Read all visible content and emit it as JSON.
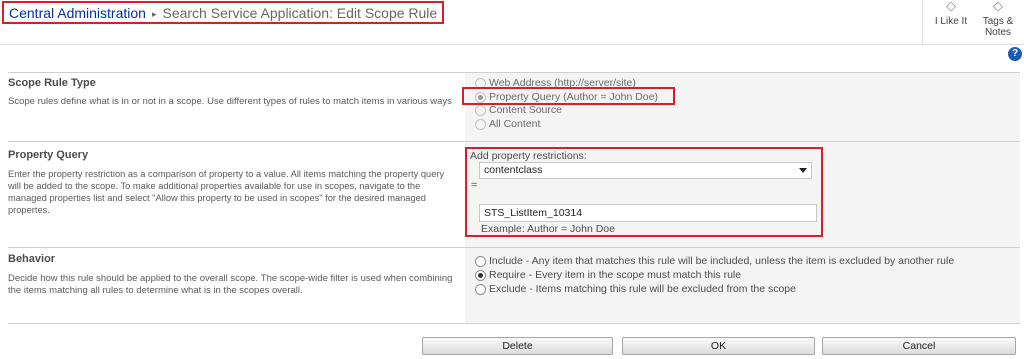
{
  "breadcrumb": {
    "root": "Central Administration",
    "separator": "▸",
    "page": "Search Service Application: Edit Scope Rule"
  },
  "ribbon": {
    "like_label": "I Like It",
    "tags_label_1": "Tags &",
    "tags_label_2": "Notes"
  },
  "help_glyph": "?",
  "scope_rule_type": {
    "title": "Scope Rule Type",
    "description": "Scope rules define what is in or not in a scope. Use different types of rules to match items in various ways",
    "options": [
      {
        "label": "Web Address (http://server/site)",
        "checked": false
      },
      {
        "label": "Property Query (Author = John Doe)",
        "checked": true
      },
      {
        "label": "Content Source",
        "checked": false
      },
      {
        "label": "All Content",
        "checked": false
      }
    ]
  },
  "property_query": {
    "title": "Property Query",
    "description": "Enter the property restriction as a comparison of property to a value. All items matching the property query will be added to the scope. To make additional properties available for use in scopes, navigate to the managed properties list and select \"Allow this property to be used in scopes\" for the desired managed propertes.",
    "add_label": "Add property restrictions:",
    "property_selected": "contentclass",
    "operator": "=",
    "value": "STS_ListItem_10314",
    "example": "Example: Author = John Doe"
  },
  "behavior": {
    "title": "Behavior",
    "description": "Decide how this rule should be applied to the overall scope. The scope-wide filter is used when combining the items matching all rules to determine what is in the scopes overall.",
    "options": [
      {
        "label": "Include - Any item that matches this rule will be included, unless the item is excluded by another rule",
        "checked": false
      },
      {
        "label": "Require - Every item in the scope must match this rule",
        "checked": true
      },
      {
        "label": "Exclude - Items matching this rule will be excluded from the scope",
        "checked": false
      }
    ]
  },
  "buttons": {
    "delete": "Delete",
    "ok": "OK",
    "cancel": "Cancel"
  },
  "colors": {
    "highlight": "#d91e2a",
    "link": "#003399",
    "pane_background": "#f4f4f4"
  }
}
